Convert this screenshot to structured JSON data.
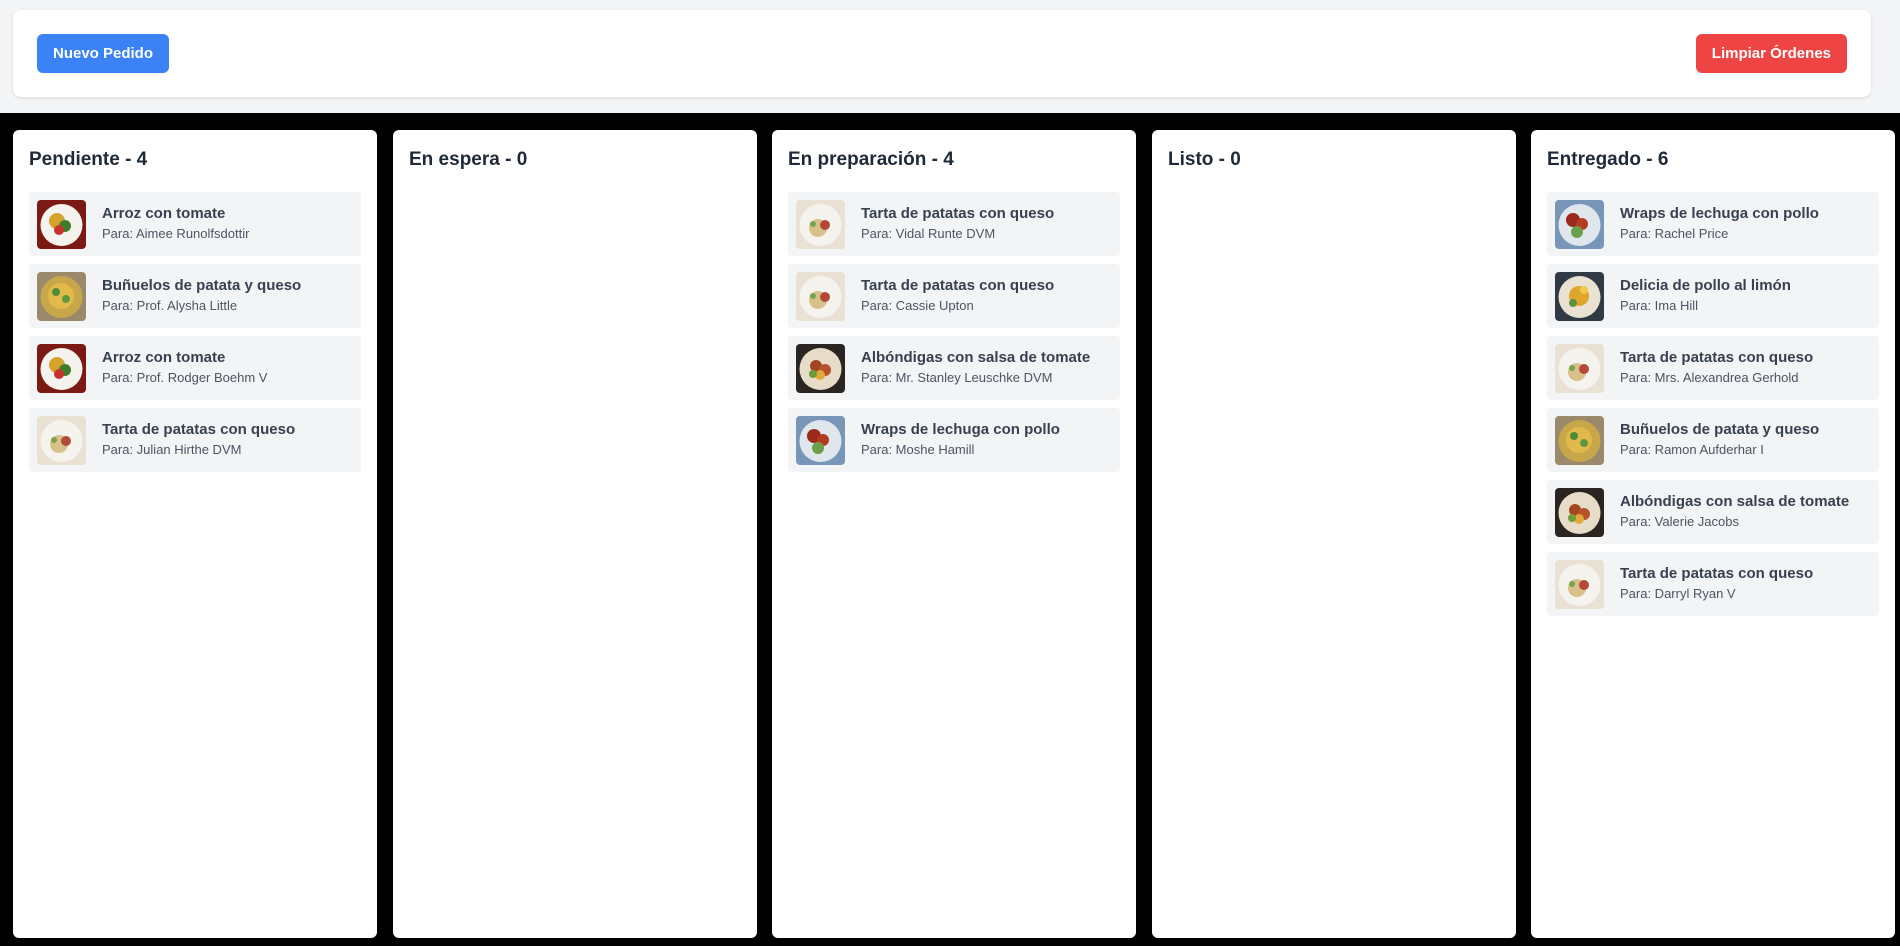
{
  "header": {
    "new_order_label": "Nuevo Pedido",
    "clear_orders_label": "Limpiar Órdenes",
    "colors": {
      "new_order": "#3b82f6",
      "clear_orders": "#ef4444"
    }
  },
  "columns": [
    {
      "title": "Pendiente - 4",
      "orders": [
        {
          "dish": "Arroz con tomate",
          "for": "Para: Aimee Runolfsdottir",
          "icon": "dish-rice-icon"
        },
        {
          "dish": "Buñuelos de patata y queso",
          "for": "Para: Prof. Alysha Little",
          "icon": "dish-fritters-icon"
        },
        {
          "dish": "Arroz con tomate",
          "for": "Para: Prof. Rodger Boehm V",
          "icon": "dish-rice-icon"
        },
        {
          "dish": "Tarta de patatas con queso",
          "for": "Para: Julian Hirthe DVM",
          "icon": "dish-potato-tart-icon"
        }
      ]
    },
    {
      "title": "En espera - 0",
      "orders": []
    },
    {
      "title": "En preparación - 4",
      "orders": [
        {
          "dish": "Tarta de patatas con queso",
          "for": "Para: Vidal Runte DVM",
          "icon": "dish-potato-tart-icon"
        },
        {
          "dish": "Tarta de patatas con queso",
          "for": "Para: Cassie Upton",
          "icon": "dish-potato-tart-icon"
        },
        {
          "dish": "Albóndigas con salsa de tomate",
          "for": "Para: Mr. Stanley Leuschke DVM",
          "icon": "dish-meatballs-icon"
        },
        {
          "dish": "Wraps de lechuga con pollo",
          "for": "Para: Moshe Hamill",
          "icon": "dish-wraps-icon"
        }
      ]
    },
    {
      "title": "Listo - 0",
      "orders": []
    },
    {
      "title": "Entregado - 6",
      "orders": [
        {
          "dish": "Wraps de lechuga con pollo",
          "for": "Para: Rachel Price",
          "icon": "dish-wraps-icon"
        },
        {
          "dish": "Delicia de pollo al limón",
          "for": "Para: Ima Hill",
          "icon": "dish-lemon-chicken-icon"
        },
        {
          "dish": "Tarta de patatas con queso",
          "for": "Para: Mrs. Alexandrea Gerhold",
          "icon": "dish-potato-tart-icon"
        },
        {
          "dish": "Buñuelos de patata y queso",
          "for": "Para: Ramon Aufderhar I",
          "icon": "dish-fritters-icon"
        },
        {
          "dish": "Albóndigas con salsa de tomate",
          "for": "Para: Valerie Jacobs",
          "icon": "dish-meatballs-icon"
        },
        {
          "dish": "Tarta de patatas con queso",
          "for": "Para: Darryl Ryan V",
          "icon": "dish-potato-tart-icon"
        }
      ]
    }
  ]
}
